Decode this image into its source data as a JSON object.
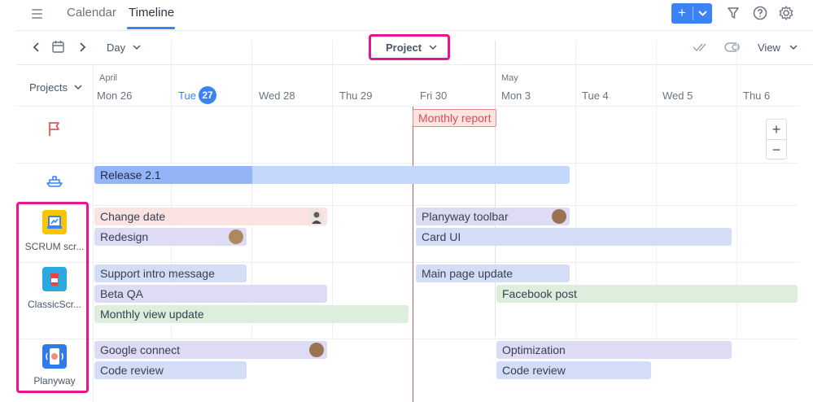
{
  "header": {
    "tabs": [
      {
        "label": "Calendar"
      },
      {
        "label": "Timeline"
      }
    ],
    "add_label": "+"
  },
  "toolbar": {
    "day_label": "Day",
    "group_label": "Project",
    "view_label": "View"
  },
  "calendar": {
    "months": [
      "April",
      "May"
    ],
    "days": [
      "Mon 26",
      "Tue",
      "Wed 28",
      "Thu 29",
      "Fri 30",
      "Mon 3",
      "Tue 4",
      "Wed 5",
      "Thu 6"
    ],
    "today_number": "27"
  },
  "sidebar": {
    "projects_label": "Projects",
    "projects": [
      {
        "name": "SCRUM scr...",
        "color": "#f7c600"
      },
      {
        "name": "ClassicScr...",
        "color": "#29a9e0"
      },
      {
        "name": "Planyway",
        "color": "#2f7bea"
      }
    ]
  },
  "milestones": {
    "release_label": "Release 2.1",
    "monthly_report_label": "Monthly report"
  },
  "cards": [
    "Change date",
    "Redesign",
    "Planyway toolbar",
    "Card UI",
    "Support intro message",
    "Beta QA",
    "Monthly view update",
    "Main page update",
    "Facebook post",
    "Google connect",
    "Code review",
    "Optimization",
    "Code review"
  ],
  "zoom": {
    "in": "+",
    "out": "−"
  },
  "colors": {
    "accent": "#3b82f6",
    "highlight": "#e5178a",
    "today_line": "#e05555"
  }
}
